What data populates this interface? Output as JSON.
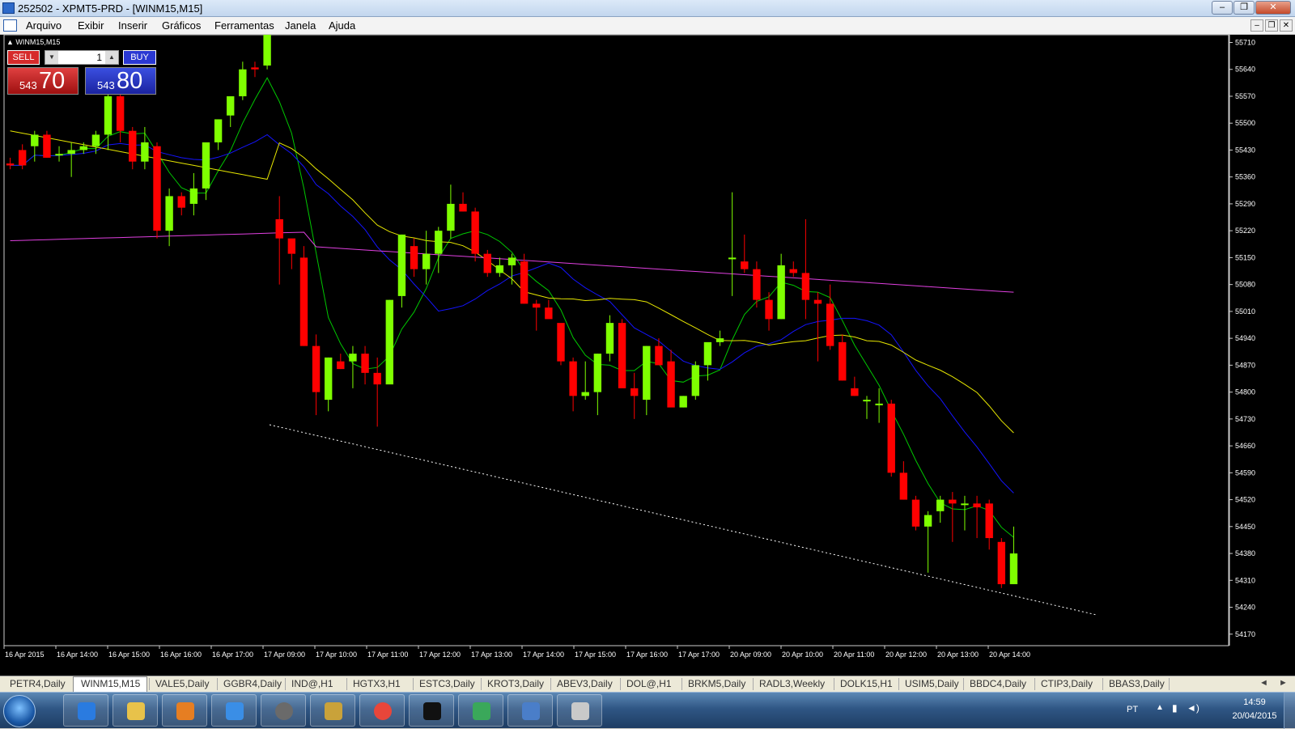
{
  "window": {
    "title": "252502 - XPMT5-PRD - [WINM15,M15]",
    "controls": [
      "–",
      "❐",
      "✕"
    ]
  },
  "menu": [
    "Arquivo",
    "Exibir",
    "Inserir",
    "Gráficos",
    "Ferramentas",
    "Janela",
    "Ajuda"
  ],
  "mdi_controls": [
    "–",
    "❐",
    "✕"
  ],
  "chart": {
    "symbol": "WINM15,M15",
    "trade_panel": {
      "sell_label": "SELL",
      "buy_label": "BUY",
      "lot": "1",
      "sell_small": "543",
      "sell_big": "70",
      "buy_small": "543",
      "buy_big": "80"
    },
    "colors": {
      "bull": "#7fff00",
      "bear": "#ff0000",
      "ma_fast": "#00c800",
      "ma_mid": "#1414ff",
      "ma_slow": "#e6e600",
      "ma_long": "#e040e0",
      "background": "#000000",
      "axis_text": "#ffffff",
      "trendline": "#ffffff"
    }
  },
  "chart_data": {
    "type": "candlestick",
    "x_labels": [
      "16 Apr 2015",
      "16 Apr 14:00",
      "16 Apr 15:00",
      "16 Apr 16:00",
      "16 Apr 17:00",
      "17 Apr 09:00",
      "17 Apr 10:00",
      "17 Apr 11:00",
      "17 Apr 12:00",
      "17 Apr 13:00",
      "17 Apr 14:00",
      "17 Apr 15:00",
      "17 Apr 16:00",
      "17 Apr 17:00",
      "20 Apr 09:00",
      "20 Apr 10:00",
      "20 Apr 11:00",
      "20 Apr 12:00",
      "20 Apr 13:00",
      "20 Apr 14:00"
    ],
    "y_ticks": [
      55710,
      55640,
      55570,
      55500,
      55430,
      55360,
      55290,
      55220,
      55150,
      55080,
      55010,
      54940,
      54870,
      54800,
      54730,
      54660,
      54590,
      54520,
      54450,
      54380,
      54310,
      54240,
      54170
    ],
    "ylim": [
      54140,
      55730
    ],
    "candles": [
      [
        55395,
        55410,
        55380,
        55390
      ],
      [
        55430,
        55445,
        55380,
        55390
      ],
      [
        55440,
        55480,
        55400,
        55470
      ],
      [
        55470,
        55480,
        55410,
        55410
      ],
      [
        55420,
        55440,
        55400,
        55420
      ],
      [
        55420,
        55450,
        55360,
        55430
      ],
      [
        55430,
        55450,
        55420,
        55440
      ],
      [
        55440,
        55480,
        55420,
        55470
      ],
      [
        55470,
        55600,
        55430,
        55570
      ],
      [
        55570,
        55580,
        55450,
        55480
      ],
      [
        55480,
        55490,
        55380,
        55400
      ],
      [
        55400,
        55490,
        55380,
        55450
      ],
      [
        55440,
        55450,
        55200,
        55220
      ],
      [
        55220,
        55330,
        55180,
        55310
      ],
      [
        55310,
        55320,
        55260,
        55280
      ],
      [
        55290,
        55370,
        55260,
        55330
      ],
      [
        55330,
        55450,
        55300,
        55450
      ],
      [
        55450,
        55510,
        55430,
        55510
      ],
      [
        55520,
        55570,
        55490,
        55570
      ],
      [
        55570,
        55660,
        55560,
        55640
      ],
      [
        55645,
        55660,
        55620,
        55640
      ],
      [
        55650,
        55730,
        55640,
        55730
      ],
      [
        55250,
        55310,
        55080,
        55200
      ],
      [
        55200,
        55160,
        55120,
        55160
      ],
      [
        55150,
        55180,
        54920,
        54920
      ],
      [
        54920,
        54950,
        54740,
        54800
      ],
      [
        54780,
        54890,
        54750,
        54890
      ],
      [
        54880,
        54900,
        54860,
        54860
      ],
      [
        54880,
        54920,
        54810,
        54900
      ],
      [
        54900,
        54920,
        54820,
        54850
      ],
      [
        54850,
        54890,
        54710,
        54820
      ],
      [
        54820,
        55040,
        54830,
        55040
      ],
      [
        55050,
        55210,
        55020,
        55210
      ],
      [
        55180,
        55200,
        55100,
        55120
      ],
      [
        55120,
        55220,
        55080,
        55160
      ],
      [
        55160,
        55230,
        55110,
        55220
      ],
      [
        55220,
        55340,
        55200,
        55290
      ],
      [
        55290,
        55320,
        55270,
        55270
      ],
      [
        55270,
        55280,
        55140,
        55160
      ],
      [
        55160,
        55170,
        55100,
        55110
      ],
      [
        55110,
        55150,
        55100,
        55130
      ],
      [
        55130,
        55160,
        55080,
        55150
      ],
      [
        55140,
        55160,
        55030,
        55030
      ],
      [
        55030,
        55040,
        54960,
        55020
      ],
      [
        55020,
        55040,
        55000,
        54990
      ],
      [
        54980,
        54970,
        54870,
        54880
      ],
      [
        54880,
        54890,
        54750,
        54790
      ],
      [
        54790,
        54880,
        54780,
        54800
      ],
      [
        54800,
        54900,
        54740,
        54900
      ],
      [
        54900,
        55000,
        54880,
        54980
      ],
      [
        54980,
        54990,
        54830,
        54810
      ],
      [
        54810,
        54850,
        54730,
        54790
      ],
      [
        54780,
        54920,
        54740,
        54920
      ],
      [
        54920,
        54940,
        54880,
        54870
      ],
      [
        54880,
        54910,
        54780,
        54760
      ],
      [
        54760,
        54790,
        54760,
        54790
      ],
      [
        54790,
        54880,
        54780,
        54870
      ],
      [
        54870,
        54920,
        54830,
        54930
      ],
      [
        54930,
        54960,
        54920,
        54940
      ],
      [
        55150,
        55320,
        55050,
        55150
      ],
      [
        55140,
        55210,
        55110,
        55120
      ],
      [
        55120,
        55140,
        55020,
        55040
      ],
      [
        55040,
        55060,
        54960,
        54990
      ],
      [
        54990,
        55160,
        54990,
        55130
      ],
      [
        55120,
        55140,
        55100,
        55110
      ],
      [
        55110,
        55250,
        54990,
        55040
      ],
      [
        55040,
        55060,
        54880,
        55030
      ],
      [
        55030,
        55080,
        54910,
        54920
      ],
      [
        54930,
        54950,
        54830,
        54830
      ],
      [
        54810,
        54840,
        54790,
        54790
      ],
      [
        54780,
        54790,
        54730,
        54780
      ],
      [
        54770,
        54810,
        54720,
        54770
      ],
      [
        54770,
        54780,
        54580,
        54590
      ],
      [
        54590,
        54620,
        54520,
        54520
      ],
      [
        54520,
        54530,
        54440,
        54450
      ],
      [
        54450,
        54490,
        54330,
        54480
      ],
      [
        54490,
        54530,
        54460,
        54520
      ],
      [
        54520,
        54540,
        54410,
        54510
      ],
      [
        54510,
        54530,
        54440,
        54510
      ],
      [
        54510,
        54530,
        54420,
        54500
      ],
      [
        54510,
        54520,
        54390,
        54420
      ],
      [
        54410,
        54420,
        54290,
        54300
      ],
      [
        54300,
        54450,
        54300,
        54380
      ]
    ],
    "trendline": [
      [
        54715,
        54220
      ]
    ],
    "moving_averages": [
      "fast",
      "mid",
      "slow",
      "long"
    ]
  },
  "tabs": [
    "PETR4,Daily",
    "WINM15,M15",
    "VALE5,Daily",
    "GGBR4,Daily",
    "IND@,H1",
    "HGTX3,H1",
    "ESTC3,Daily",
    "KROT3,Daily",
    "ABEV3,Daily",
    "DOL@,H1",
    "BRKM5,Daily",
    "RADL3,Weekly",
    "DOLK15,H1",
    "USIM5,Daily",
    "BBDC4,Daily",
    "CTIP3,Daily",
    "BBAS3,Daily"
  ],
  "tab_active": "WINM15,M15",
  "taskbar": {
    "icons": [
      "internet-explorer-icon",
      "file-explorer-icon",
      "media-player-icon",
      "network-icon",
      "hp-icon",
      "archive-icon",
      "chrome-icon",
      "xp-icon",
      "metatrader-icon",
      "photo-icon",
      "paint-icon"
    ],
    "lang": "PT",
    "time": "14:59",
    "date": "20/04/2015"
  }
}
